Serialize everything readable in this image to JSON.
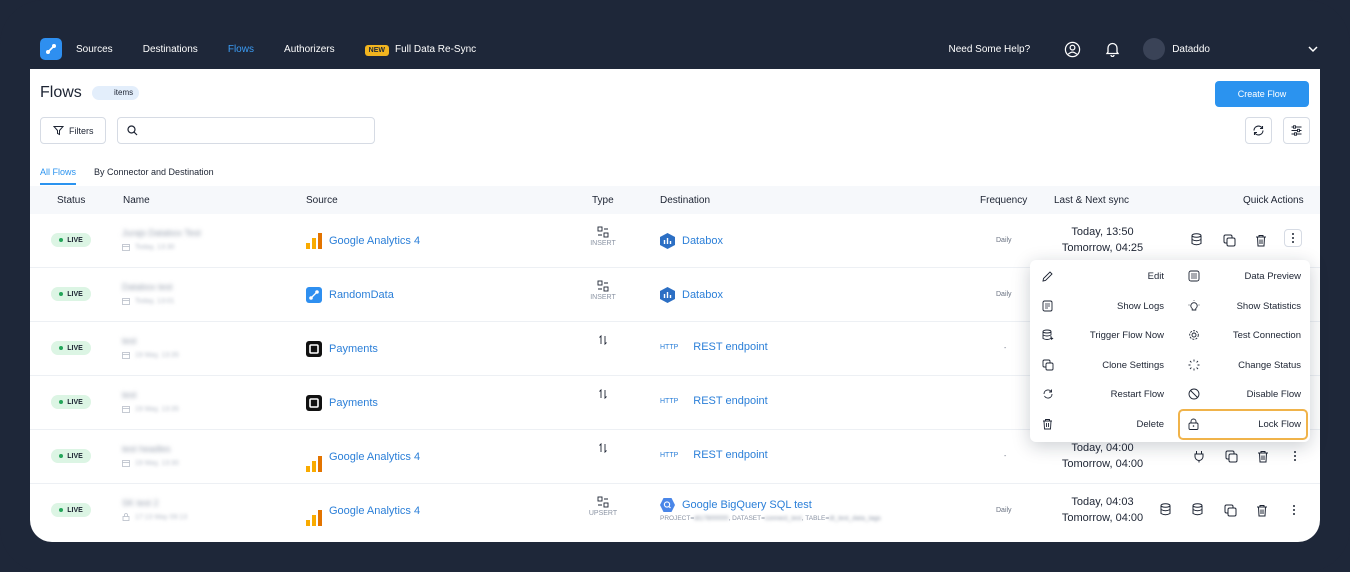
{
  "nav": {
    "items": [
      "Sources",
      "Destinations",
      "Flows",
      "Authorizers"
    ],
    "active": "Flows",
    "new_badge": "NEW",
    "resync_label": "Full Data Re-Sync",
    "help": "Need Some Help?",
    "user": "Dataddo"
  },
  "header": {
    "title": "Flows",
    "items_label": "items",
    "create_button": "Create Flow",
    "filters_label": "Filters",
    "search_value": ""
  },
  "tabs": [
    "All Flows",
    "By Connector and Destination"
  ],
  "columns": [
    "Status",
    "Name",
    "Source",
    "Type",
    "Destination",
    "Frequency",
    "Last & Next sync",
    "Quick Actions"
  ],
  "rows": [
    {
      "status": "LIVE",
      "name": "Jurajs Databox Test",
      "date": "Today, 13:30",
      "source": "Google Analytics 4",
      "source_icon": "ga4-icon",
      "type": "INSERT",
      "destination": "Databox",
      "dest_http": "",
      "frequency": "Daily",
      "last_sync": "Today, 13:50",
      "next_sync": "Tomorrow, 04:25"
    },
    {
      "status": "LIVE",
      "name": "Databox test",
      "date": "Today, 13:01",
      "source": "RandomData",
      "source_icon": "randomdata-icon",
      "type": "INSERT",
      "destination": "Databox",
      "dest_http": "",
      "frequency": "Daily",
      "last_sync": "",
      "next_sync": ""
    },
    {
      "status": "LIVE",
      "name": "test",
      "date": "19 May, 13:35",
      "source": "Payments",
      "source_icon": "square-icon",
      "type": "",
      "destination": "REST endpoint",
      "dest_http": "HTTP",
      "frequency": "-",
      "last_sync": "",
      "next_sync": ""
    },
    {
      "status": "LIVE",
      "name": "test",
      "date": "19 May, 13:35",
      "source": "Payments",
      "source_icon": "square-icon",
      "type": "",
      "destination": "REST endpoint",
      "dest_http": "HTTP",
      "frequency": "-",
      "last_sync": "",
      "next_sync": ""
    },
    {
      "status": "LIVE",
      "name": "test headles",
      "date": "19 May, 13:30",
      "source": "Google Analytics 4",
      "source_icon": "ga4-icon",
      "type": "",
      "destination": "REST endpoint",
      "dest_http": "HTTP",
      "frequency": "-",
      "last_sync": "Today, 04:00",
      "next_sync": "Tomorrow, 04:00"
    },
    {
      "status": "LIVE",
      "name": "SK test 2",
      "date": "17:13 May 09:13",
      "source": "Google Analytics 4",
      "source_icon": "ga4-icon",
      "type": "UPSERT",
      "destination": "Google BigQuery SQL test",
      "dest_http": "",
      "dest_details_prefixes": [
        "PROJECT=",
        ", DATASET=",
        ", TABLE="
      ],
      "dest_details_values": [
        "dt17800000",
        "connect_test",
        "dt_test_data_tags"
      ],
      "frequency": "Daily",
      "last_sync": "Today, 04:03",
      "next_sync": "Tomorrow, 04:00"
    }
  ],
  "menu": {
    "left": [
      "Edit",
      "Show Logs",
      "Trigger Flow Now",
      "Clone Settings",
      "Restart Flow",
      "Delete"
    ],
    "right": [
      "Data Preview",
      "Show Statistics",
      "Test Connection",
      "Change Status",
      "Disable Flow",
      "Lock Flow"
    ]
  },
  "colors": {
    "accent": "#2b93ef",
    "live": "#23a559",
    "highlight": "#f0b34a",
    "dark": "#1e2739"
  }
}
